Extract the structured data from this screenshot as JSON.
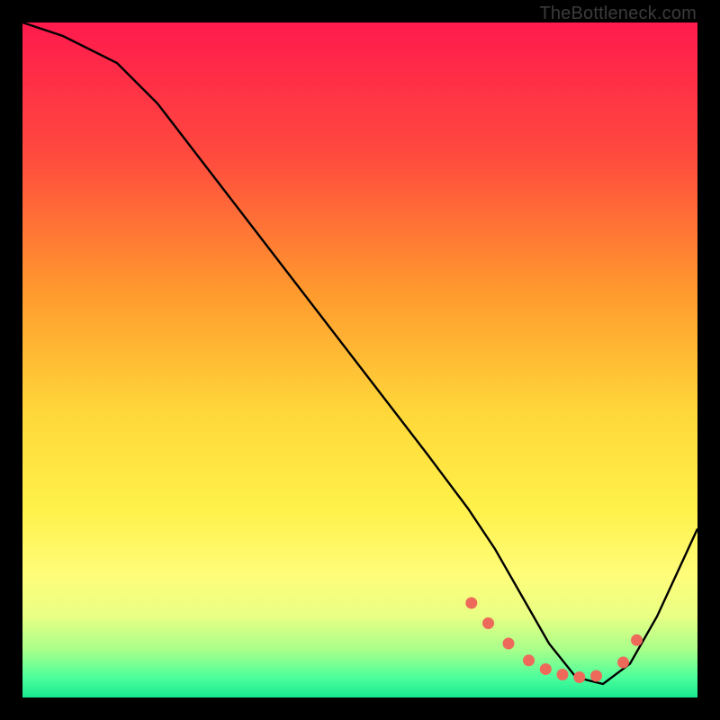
{
  "watermark": "TheBottleneck.com",
  "chart_data": {
    "type": "line",
    "title": "",
    "xlabel": "",
    "ylabel": "",
    "xlim": [
      0,
      100
    ],
    "ylim": [
      0,
      100
    ],
    "series": [
      {
        "name": "curve",
        "x": [
          0,
          6,
          14,
          20,
          30,
          40,
          50,
          60,
          66,
          70,
          74,
          78,
          82,
          86,
          90,
          94,
          100
        ],
        "y": [
          100,
          98,
          94,
          88,
          75,
          62,
          49,
          36,
          28,
          22,
          15,
          8,
          3,
          2,
          5,
          12,
          25
        ]
      }
    ],
    "markers": {
      "name": "dots",
      "x": [
        66.5,
        69,
        72,
        75,
        77.5,
        80,
        82.5,
        85,
        89,
        91
      ],
      "y": [
        14,
        11,
        8,
        5.5,
        4.2,
        3.4,
        3.0,
        3.2,
        5.2,
        8.5
      ]
    },
    "gradient_stops": [
      {
        "offset": 0.0,
        "color": "#ff1a4d"
      },
      {
        "offset": 0.2,
        "color": "#ff4b3e"
      },
      {
        "offset": 0.4,
        "color": "#ff9a2e"
      },
      {
        "offset": 0.58,
        "color": "#ffd83a"
      },
      {
        "offset": 0.72,
        "color": "#fff14a"
      },
      {
        "offset": 0.82,
        "color": "#fffd7a"
      },
      {
        "offset": 0.88,
        "color": "#e8ff84"
      },
      {
        "offset": 0.93,
        "color": "#a7ff8a"
      },
      {
        "offset": 0.97,
        "color": "#4dff9c"
      },
      {
        "offset": 1.0,
        "color": "#19e890"
      }
    ],
    "marker_color": "#ed6a5a",
    "line_color": "#000000"
  }
}
